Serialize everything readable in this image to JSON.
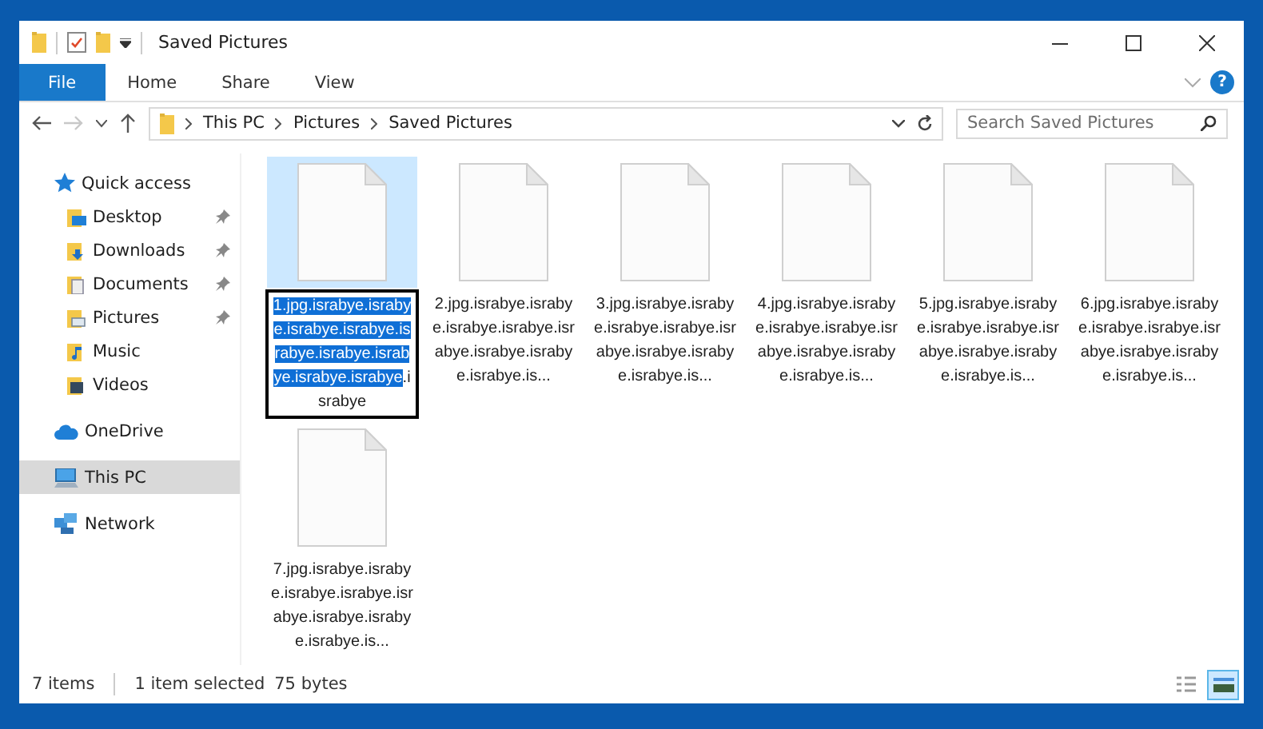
{
  "window": {
    "title": "Saved Pictures"
  },
  "ribbon": {
    "tabs": [
      {
        "label": "File",
        "kind": "file"
      },
      {
        "label": "Home",
        "kind": "tab"
      },
      {
        "label": "Share",
        "kind": "tab"
      },
      {
        "label": "View",
        "kind": "tab"
      }
    ],
    "help": "?"
  },
  "address": {
    "breadcrumbs": [
      "This PC",
      "Pictures",
      "Saved Pictures"
    ],
    "forward_disabled": true
  },
  "search": {
    "placeholder": "Search Saved Pictures"
  },
  "sidebar": {
    "items": [
      {
        "label": "Quick access",
        "selected": false,
        "children": [
          {
            "label": "Desktop",
            "pinned": true,
            "selected": false
          },
          {
            "label": "Downloads",
            "pinned": true,
            "selected": false
          },
          {
            "label": "Documents",
            "pinned": true,
            "selected": false
          },
          {
            "label": "Pictures",
            "pinned": true,
            "selected": false
          },
          {
            "label": "Music",
            "pinned": false,
            "selected": false
          },
          {
            "label": "Videos",
            "pinned": false,
            "selected": false
          }
        ]
      },
      {
        "label": "OneDrive",
        "selected": false
      },
      {
        "label": "This PC",
        "selected": true
      },
      {
        "label": "Network",
        "selected": false
      }
    ]
  },
  "files": [
    {
      "selected": true,
      "editing": true,
      "name_selected": "1.jpg.israbye.israbye.israbye.israbye.israbye.israbye.israbye.israbye.israbye",
      "name_rest": ".israbye"
    },
    {
      "selected": false,
      "editing": false,
      "name": "2.jpg.israbye.israbye.israbye.israbye.israbye.israbye.israbye.israbye.is..."
    },
    {
      "selected": false,
      "editing": false,
      "name": "3.jpg.israbye.israbye.israbye.israbye.israbye.israbye.israbye.israbye.is..."
    },
    {
      "selected": false,
      "editing": false,
      "name": "4.jpg.israbye.israbye.israbye.israbye.israbye.israbye.israbye.israbye.is..."
    },
    {
      "selected": false,
      "editing": false,
      "name": "5.jpg.israbye.israbye.israbye.israbye.israbye.israbye.israbye.israbye.is..."
    },
    {
      "selected": false,
      "editing": false,
      "name": "6.jpg.israbye.israbye.israbye.israbye.israbye.israbye.israbye.israbye.is..."
    },
    {
      "selected": false,
      "editing": false,
      "name": "7.jpg.israbye.israbye.israbye.israbye.israbye.israbye.israbye.israbye.is..."
    }
  ],
  "status_bar": {
    "item_count": "7 items",
    "selection": "1 item selected",
    "size": "75 bytes",
    "views": [
      {
        "kind": "details",
        "selected": false
      },
      {
        "kind": "large-icons",
        "selected": true
      }
    ]
  }
}
